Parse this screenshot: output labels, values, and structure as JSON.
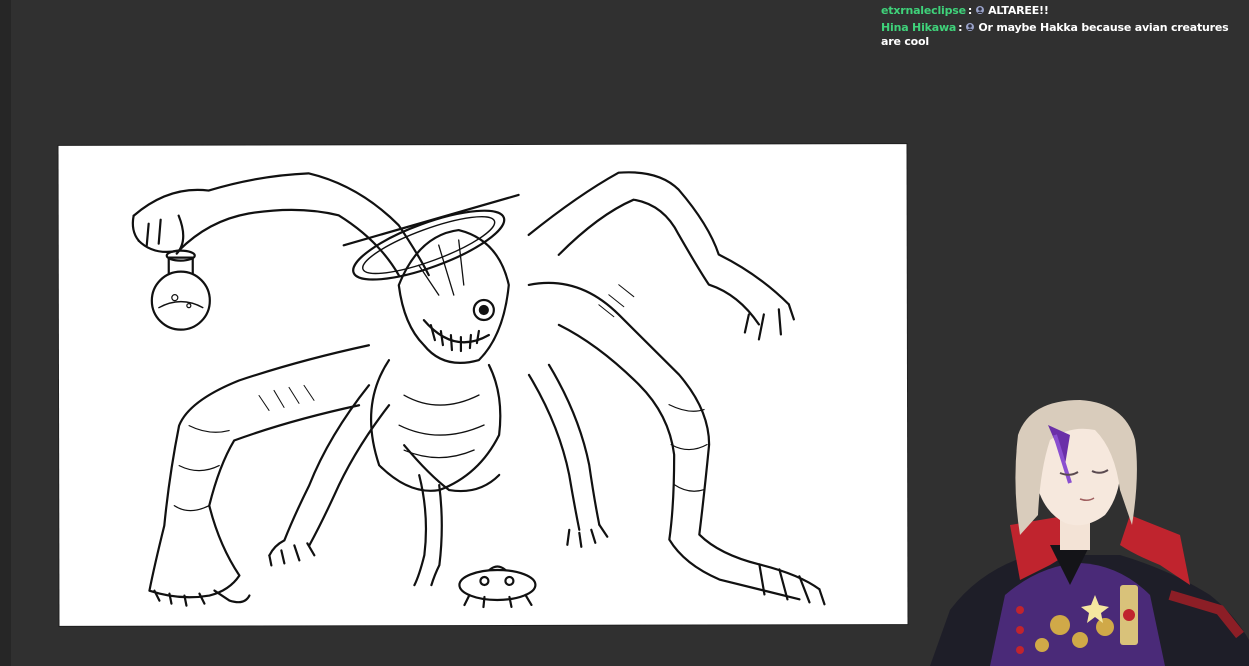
{
  "chat": {
    "messages": [
      {
        "user": "etxrnaleclipse",
        "separator": ":",
        "badge": "user-badge-icon",
        "text": "ALTAREE!!"
      },
      {
        "user": "Hina Hikawa",
        "separator": ":",
        "badge": "user-badge-icon",
        "text": "Or maybe Hakka because avian creatures are cool"
      }
    ]
  },
  "colors": {
    "background": "#303030",
    "canvas": "#ffffff",
    "username": "#3fd27a",
    "chat_text": "#ffffff",
    "ink": "#111111",
    "avatar_coat": "#4a2a78",
    "avatar_collar": "#c0242e",
    "avatar_hair": "#d9ccbc",
    "avatar_accent": "#e8c040"
  },
  "canvas": {
    "subject": "ink drawing of a many-limbed creature holding a flask"
  },
  "avatar": {
    "subject": "vtuber-avatar"
  }
}
